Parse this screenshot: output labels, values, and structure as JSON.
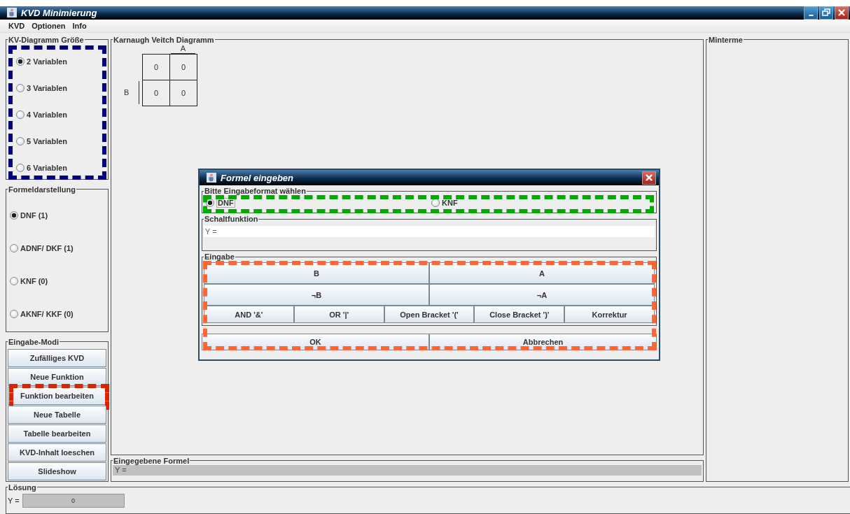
{
  "window": {
    "title": "KVD Minimierung"
  },
  "menu": [
    "KVD",
    "Optionen",
    "Info"
  ],
  "size_group": {
    "title": "KV-Diagramm Größe",
    "highlighted": true,
    "options": [
      {
        "label": "2 Variablen",
        "selected": true
      },
      {
        "label": "3 Variablen",
        "selected": false
      },
      {
        "label": "4 Variablen",
        "selected": false
      },
      {
        "label": "5 Variablen",
        "selected": false
      },
      {
        "label": "6 Variablen",
        "selected": false
      }
    ]
  },
  "format_group": {
    "title": "Formeldarstellung",
    "options": [
      {
        "label": "DNF (1)",
        "selected": true
      },
      {
        "label": "ADNF/ DKF (1)",
        "selected": false
      },
      {
        "label": "KNF (0)",
        "selected": false
      },
      {
        "label": "AKNF/ KKF (0)",
        "selected": false
      }
    ]
  },
  "mode_group": {
    "title": "Eingabe-Modi",
    "buttons": [
      {
        "label": "Zufälliges KVD"
      },
      {
        "label": "Neue Funktion"
      },
      {
        "label": "Funktion bearbeiten",
        "highlighted": true
      },
      {
        "label": "Neue Tabelle"
      },
      {
        "label": "Tabelle bearbeiten"
      },
      {
        "label": "KVD-Inhalt loeschen"
      },
      {
        "label": "Slideshow"
      }
    ]
  },
  "kv_diagram": {
    "title": "Karnaugh Veitch Diagramm",
    "col_label": "A",
    "row_label": "B",
    "cells": [
      [
        "0",
        "0"
      ],
      [
        "0",
        "0"
      ]
    ]
  },
  "entered_formula": {
    "title": "Eingegebene Formel",
    "value": "Y ="
  },
  "minterms": {
    "title": "Minterme"
  },
  "solution": {
    "title": "Lösung",
    "label": "Y =",
    "value": "0"
  },
  "dialog": {
    "title": "Formel eingeben",
    "format_group": {
      "title": "Bitte Eingabeformat wählen",
      "highlighted": true,
      "options": [
        {
          "label": "DNF",
          "selected": true
        },
        {
          "label": "KNF",
          "selected": false
        }
      ]
    },
    "function_group": {
      "title": "Schaltfunktion",
      "value": "Y ="
    },
    "input_group": {
      "title": "Eingabe",
      "highlighted": true,
      "rows": [
        [
          "B",
          "A"
        ],
        [
          "¬B",
          "¬A"
        ],
        [
          "AND '&'",
          "OR '|'",
          "Open Bracket '('",
          "Close Bracket ')'",
          "Korrektur"
        ]
      ]
    },
    "buttons": [
      "OK",
      "Abbrechen"
    ]
  }
}
